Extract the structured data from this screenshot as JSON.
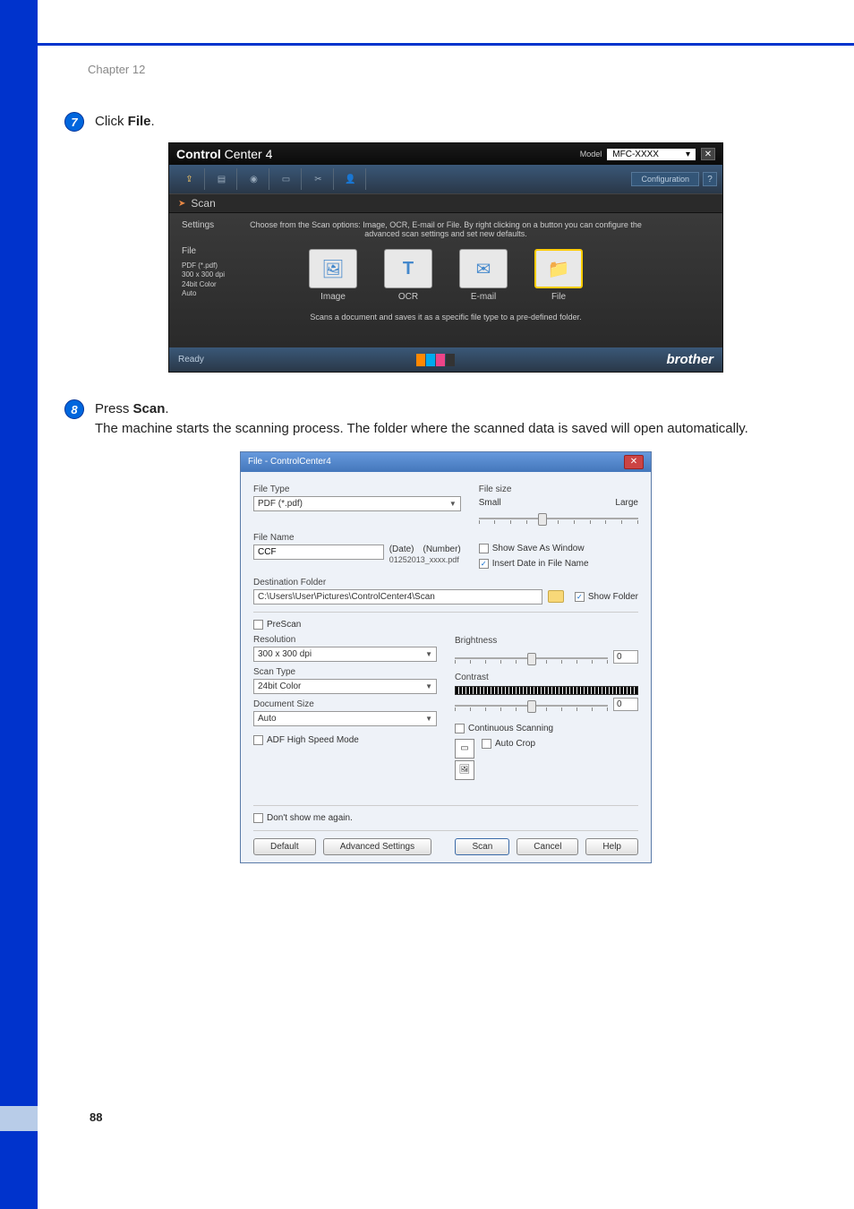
{
  "page": {
    "chapter": "Chapter 12",
    "number": "88"
  },
  "step7": {
    "num": "7",
    "pre": "Click ",
    "bold": "File",
    "post": "."
  },
  "step8": {
    "num": "8",
    "pre": "Press ",
    "bold": "Scan",
    "post": ".",
    "line2": "The machine starts the scanning process. The folder where the scanned data is saved will open automatically."
  },
  "cc": {
    "title_bold": "Control",
    "title_rest": " Center 4",
    "model_label": "Model",
    "model_value": "MFC-XXXX",
    "config": "Configuration",
    "tab": "Scan",
    "desc": "Choose from the Scan options: Image, OCR, E-mail or File. By right clicking on a button you can configure the advanced scan settings and set new defaults.",
    "side_settings": "Settings",
    "side_file": "File",
    "side_detail1": "PDF (*.pdf)",
    "side_detail2": "300 x 300 dpi",
    "side_detail3": "24bit Color",
    "side_detail4": "Auto",
    "opt_image": "Image",
    "opt_ocr": "OCR",
    "opt_email": "E-mail",
    "opt_file": "File",
    "footer_desc": "Scans a document and saves it as a specific file type to a pre-defined folder.",
    "status": "Ready",
    "brand": "brother"
  },
  "fd": {
    "title": "File - ControlCenter4",
    "file_type_label": "File Type",
    "file_type_value": "PDF (*.pdf)",
    "file_size_label": "File size",
    "file_size_small": "Small",
    "file_size_large": "Large",
    "file_name_label": "File Name",
    "file_name_value": "CCF",
    "date_label": "(Date)",
    "number_label": "(Number)",
    "file_name_preview": "01252013_xxxx.pdf",
    "show_save_as": "Show Save As Window",
    "insert_date": "Insert Date in File Name",
    "dest_folder_label": "Destination Folder",
    "dest_folder_value": "C:\\Users\\User\\Pictures\\ControlCenter4\\Scan",
    "show_folder": "Show Folder",
    "pre_scan": "PreScan",
    "resolution_label": "Resolution",
    "resolution_value": "300 x 300 dpi",
    "scan_type_label": "Scan Type",
    "scan_type_value": "24bit Color",
    "doc_size_label": "Document Size",
    "doc_size_value": "Auto",
    "adf_high_speed": "ADF High Speed Mode",
    "brightness_label": "Brightness",
    "brightness_value": "0",
    "contrast_label": "Contrast",
    "contrast_value": "0",
    "continuous": "Continuous Scanning",
    "auto_crop": "Auto Crop",
    "dont_show": "Don't show me again.",
    "btn_default": "Default",
    "btn_advanced": "Advanced Settings",
    "btn_scan": "Scan",
    "btn_cancel": "Cancel",
    "btn_help": "Help"
  }
}
